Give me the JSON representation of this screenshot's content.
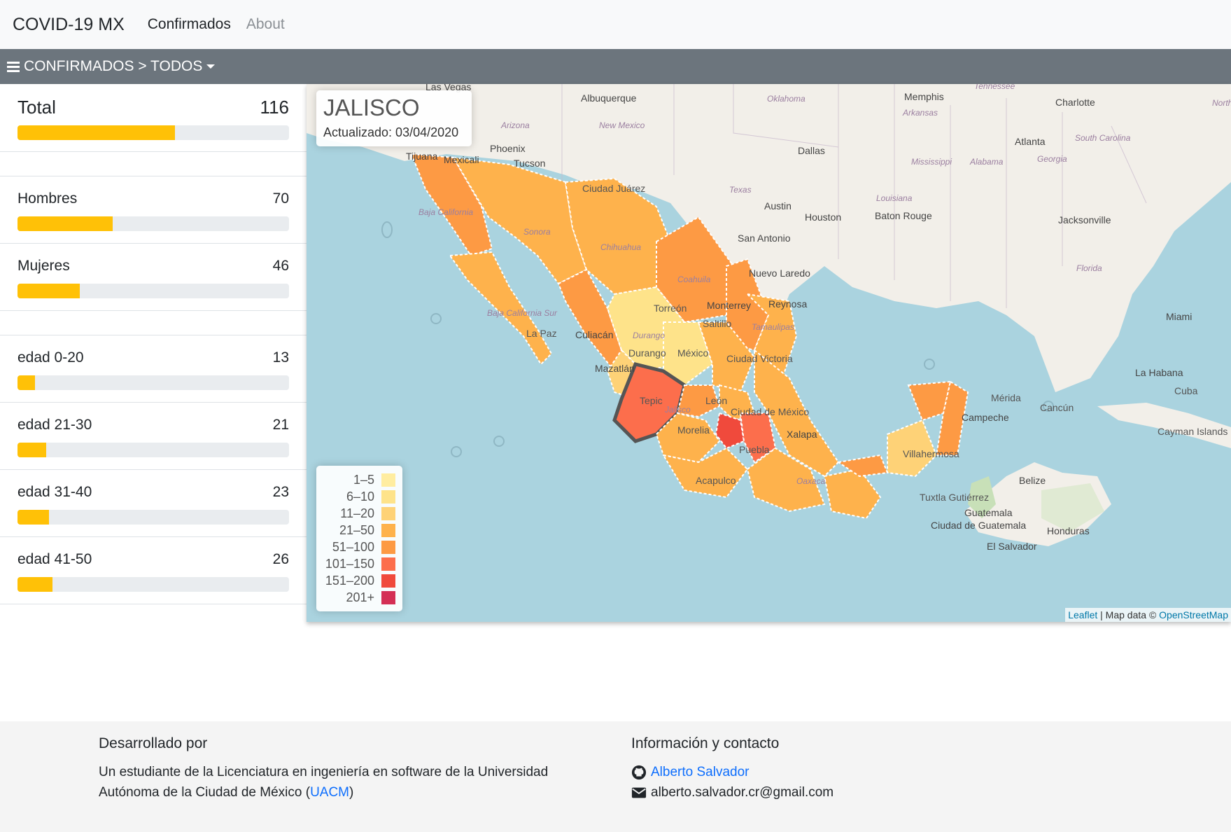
{
  "navbar": {
    "brand": "COVID-19 MX",
    "links": [
      "Confirmados",
      "About"
    ]
  },
  "subbar": {
    "label": "CONFIRMADOS > TODOS"
  },
  "sidebar": {
    "total": {
      "label": "Total",
      "value": "116",
      "progress": 0.58
    },
    "gender": [
      {
        "label": "Hombres",
        "value": "70",
        "progress": 0.35
      },
      {
        "label": "Mujeres",
        "value": "46",
        "progress": 0.23
      }
    ],
    "ages": [
      {
        "label": "edad 0-20",
        "value": "13",
        "progress": 0.065
      },
      {
        "label": "edad 21-30",
        "value": "21",
        "progress": 0.105
      },
      {
        "label": "edad 31-40",
        "value": "23",
        "progress": 0.115
      },
      {
        "label": "edad 41-50",
        "value": "26",
        "progress": 0.13
      }
    ],
    "bar_color": "#ffc107"
  },
  "map": {
    "info": {
      "state": "JALISCO",
      "updated": "Actualizado: 03/04/2020"
    },
    "legend": [
      {
        "label": "1–5",
        "color": "#ffeda0"
      },
      {
        "label": "6–10",
        "color": "#fee38a"
      },
      {
        "label": "11–20",
        "color": "#fed277"
      },
      {
        "label": "21–50",
        "color": "#feb24c"
      },
      {
        "label": "51–100",
        "color": "#fd9a44"
      },
      {
        "label": "101–150",
        "color": "#fc6e4c"
      },
      {
        "label": "151–200",
        "color": "#f04a3c"
      },
      {
        "label": "201+",
        "color": "#d42f55"
      }
    ],
    "attribution": {
      "leaflet": "Leaflet",
      "sep": " | Map data © ",
      "osm": "OpenStreetMap"
    },
    "places": [
      "Las Vegas",
      "Albuquerque",
      "Oklahoma",
      "Memphis",
      "Tennessee",
      "Charlotte",
      "North",
      "Arizona",
      "New Mexico",
      "Arkansas",
      "Phoenix",
      "Tucson",
      "Dallas",
      "Atlanta",
      "South Carolina",
      "Georgia",
      "Tijuana",
      "Mexicali",
      "Mississippi",
      "Alabama",
      "Ciudad Juárez",
      "Texas",
      "Louisiana",
      "Austin",
      "Houston",
      "Baton Rouge",
      "Jacksonville",
      "Baja California",
      "Sonora",
      "San Antonio",
      "Chihuahua",
      "Coahuila",
      "Nuevo Laredo",
      "Florida",
      "Monterrey",
      "Reynosa",
      "Torreón",
      "Miami",
      "Baja California Sur",
      "Saltillo",
      "Tamaulipas",
      "La Paz",
      "Culiacán",
      "Durango",
      "México",
      "Ciudad Victoria",
      "Durango",
      "Mazatlán",
      "La Habana",
      "Cuba",
      "León",
      "Jalisco",
      "Mérida",
      "Cancún",
      "Ciudad de México",
      "Campeche",
      "Morelia",
      "Xalapa",
      "Cayman Islands",
      "Puebla",
      "Villahermosa",
      "Acapulco",
      "Oaxaca",
      "Belize",
      "Tuxtla Gutiérrez",
      "Guatemala",
      "Honduras",
      "Ciudad de Guatemala",
      "El Salvador",
      "Tepic"
    ]
  },
  "footer": {
    "left": {
      "title": "Desarrollado por",
      "text_prefix": "Un estudiante de la Licenciatura en ingeniería en software de la Universidad Autónoma de la Ciudad de México (",
      "link": "UACM",
      "text_suffix": ")"
    },
    "right": {
      "title": "Información y contacto",
      "github": "Alberto Salvador",
      "email": "alberto.salvador.cr@gmail.com"
    }
  }
}
